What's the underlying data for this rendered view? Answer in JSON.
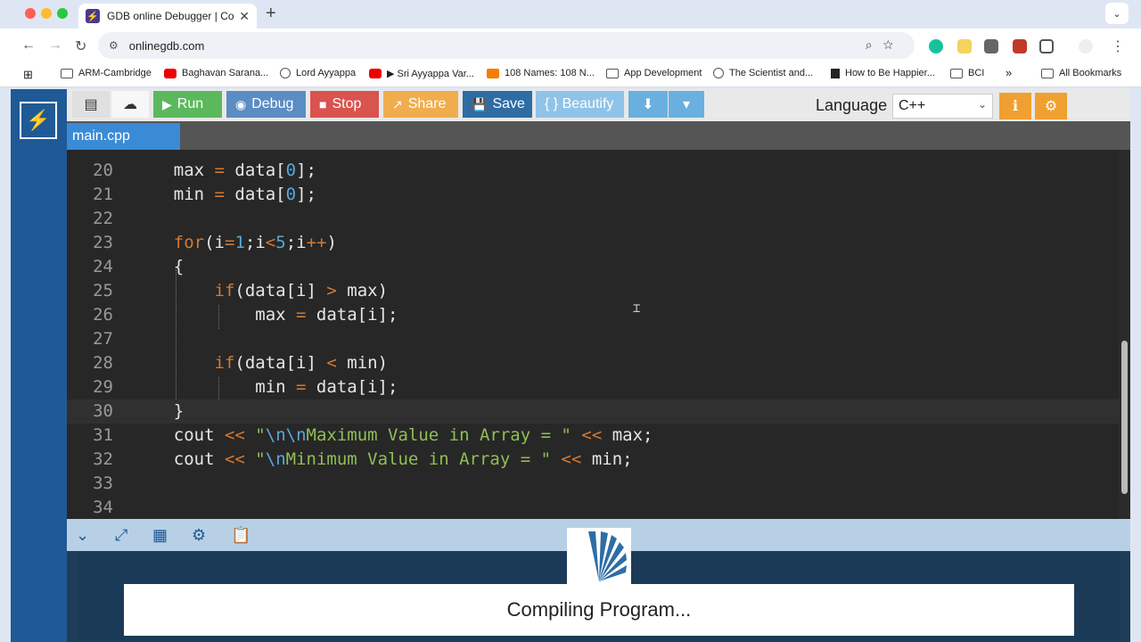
{
  "browser": {
    "tab_title": "GDB online Debugger | Comp",
    "url": "onlinegdb.com",
    "bookmarks": [
      {
        "label": "ARM-Cambridge",
        "icon": "folder-icon"
      },
      {
        "label": "Baghavan Sarana...",
        "icon": "youtube-icon"
      },
      {
        "label": "Lord Ayyappa",
        "icon": "globe-icon"
      },
      {
        "label": "▶ Sri Ayyappa Var...",
        "icon": "youtube-icon"
      },
      {
        "label": "108 Names: 108 N...",
        "icon": "blogger-icon"
      },
      {
        "label": "App Development",
        "icon": "folder-icon"
      },
      {
        "label": "The Scientist and...",
        "icon": "globe-icon"
      },
      {
        "label": "How to Be Happier...",
        "icon": "figure-icon"
      },
      {
        "label": "BCI",
        "icon": "folder-icon"
      }
    ],
    "all_bookmarks": "All Bookmarks",
    "more": "»"
  },
  "toolbar": {
    "run": "Run",
    "debug": "Debug",
    "stop": "Stop",
    "share": "Share",
    "save": "Save",
    "beautify": "{ } Beautify",
    "language_label": "Language",
    "language_value": "C++"
  },
  "file_tab": "main.cpp",
  "editor": {
    "lines": [
      {
        "n": "20",
        "html": "    max <span class='op'>=</span> data[<span class='num'>0</span>];"
      },
      {
        "n": "21",
        "html": "    min <span class='op'>=</span> data[<span class='num'>0</span>];"
      },
      {
        "n": "22",
        "html": ""
      },
      {
        "n": "23",
        "html": "    <span class='kw'>for</span>(i<span class='op'>=</span><span class='num'>1</span>;i<span class='op'>&lt;</span><span class='num'>5</span>;i<span class='op'>++</span>)"
      },
      {
        "n": "24",
        "html": "    {"
      },
      {
        "n": "25",
        "html": "        <span class='kw'>if</span>(data[i] <span class='op'>&gt;</span> max)"
      },
      {
        "n": "26",
        "html": "            max <span class='op'>=</span> data[i];"
      },
      {
        "n": "27",
        "html": ""
      },
      {
        "n": "28",
        "html": "        <span class='kw'>if</span>(data[i] <span class='op'>&lt;</span> min)"
      },
      {
        "n": "29",
        "html": "            min <span class='op'>=</span> data[i];"
      },
      {
        "n": "30",
        "html": "    }"
      },
      {
        "n": "31",
        "html": "    cout <span class='op'>&lt;&lt;</span> <span class='str'>\"<span class='esc'>\\n\\n</span>Maximum Value in Array = \"</span> <span class='op'>&lt;&lt;</span> max;"
      },
      {
        "n": "32",
        "html": "    cout <span class='op'>&lt;&lt;</span> <span class='str'>\"<span class='esc'>\\n</span>Minimum Value in Array = \"</span> <span class='op'>&lt;&lt;</span> min;"
      },
      {
        "n": "33",
        "html": ""
      },
      {
        "n": "34",
        "html": ""
      }
    ]
  },
  "status": "Compiling Program...",
  "colors": {
    "run": "#5cb85c",
    "debug": "#5b8cc4",
    "stop": "#d9534f",
    "share": "#f0ad4e",
    "save": "#2e6da4",
    "beautify": "#8fc3e8",
    "download": "#6ab0de"
  }
}
